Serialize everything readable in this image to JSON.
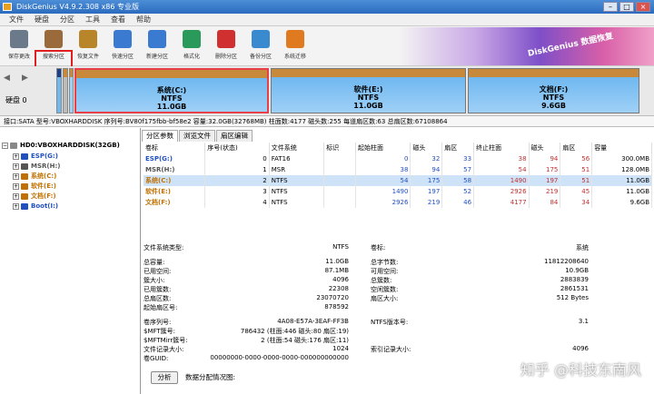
{
  "titlebar": {
    "title": "DiskGenius V4.9.2.308 x86 专业版"
  },
  "menu": [
    "文件",
    "硬盘",
    "分区",
    "工具",
    "查看",
    "帮助"
  ],
  "toolbar": [
    {
      "label": "保存更改",
      "color": "#6a7a8a"
    },
    {
      "label": "搜索分区",
      "color": "#9a6a3a"
    },
    {
      "label": "恢复文件",
      "color": "#b8852a"
    },
    {
      "label": "快速分区",
      "color": "#3a7ad0"
    },
    {
      "label": "新建分区",
      "color": "#3a7ad0"
    },
    {
      "label": "格式化",
      "color": "#2a9a5a"
    },
    {
      "label": "删除分区",
      "color": "#d03030"
    },
    {
      "label": "备份分区",
      "color": "#3a8ad0"
    },
    {
      "label": "系统迁移",
      "color": "#e07a20"
    }
  ],
  "banner_text": "DiskGenius 数据恢复",
  "disk_nav": {
    "label": "硬盘 0"
  },
  "partitions_bar": [
    {
      "name": "系统(C:)",
      "fs": "NTFS",
      "size": "11.0GB"
    },
    {
      "name": "软件(E:)",
      "fs": "NTFS",
      "size": "11.0GB"
    },
    {
      "name": "文档(F:)",
      "fs": "NTFS",
      "size": "9.6GB"
    }
  ],
  "infobar": "接口:SATA  型号:VBOXHARDDISK  序列号:BV80f175fbb-bf58e2  容量:32.0GB(32768MB)  柱面数:4177  磁头数:255  每道扇区数:63  总扇区数:67108864",
  "tree": {
    "disk": "HD0:VBOXHARDDISK(32GB)",
    "items": [
      {
        "label": "ESP(G:)",
        "color": "#2050c0"
      },
      {
        "label": "MSR(H:)",
        "color": "#555555"
      },
      {
        "label": "系统(C:)",
        "color": "#c07000"
      },
      {
        "label": "软件(E:)",
        "color": "#c07000"
      },
      {
        "label": "文档(F:)",
        "color": "#c07000"
      },
      {
        "label": "Boot(I:)",
        "color": "#2050c0"
      }
    ]
  },
  "tabs": [
    "分区参数",
    "浏览文件",
    "扇区编辑"
  ],
  "table": {
    "headers": [
      "卷标",
      "序号(状态)",
      "文件系统",
      "标识",
      "起始柱面",
      "磁头",
      "扇区",
      "终止柱面",
      "磁头",
      "扇区",
      "容量"
    ],
    "rows": [
      {
        "label": "ESP(G:)",
        "cells": [
          "0",
          "FAT16",
          "",
          "0",
          "32",
          "33",
          "38",
          "94",
          "56",
          "300.0MB"
        ]
      },
      {
        "label": "MSR(H:)",
        "cells": [
          "1",
          "MSR",
          "",
          "38",
          "94",
          "57",
          "54",
          "175",
          "51",
          "128.0MB"
        ]
      },
      {
        "label": "系统(C:)",
        "cells": [
          "2",
          "NTFS",
          "",
          "54",
          "175",
          "58",
          "1490",
          "197",
          "51",
          "11.0GB"
        ]
      },
      {
        "label": "软件(E:)",
        "cells": [
          "3",
          "NTFS",
          "",
          "1490",
          "197",
          "52",
          "2926",
          "219",
          "45",
          "11.0GB"
        ]
      },
      {
        "label": "文档(F:)",
        "cells": [
          "4",
          "NTFS",
          "",
          "2926",
          "219",
          "46",
          "4177",
          "84",
          "34",
          "9.6GB"
        ]
      }
    ]
  },
  "details": {
    "fs_type_label": "文件系统类型:",
    "fs_type": "NTFS",
    "vol_label": "卷标:",
    "vol": "系统",
    "rows1": [
      {
        "l": "总容量:",
        "v": "11.0GB",
        "l2": "总字节数:",
        "v2": "11812208640"
      },
      {
        "l": "已用空间:",
        "v": "87.1MB",
        "l2": "可用空间:",
        "v2": "10.9GB"
      },
      {
        "l": "簇大小:",
        "v": "4096",
        "l2": "总簇数:",
        "v2": "2883839"
      },
      {
        "l": "已用簇数:",
        "v": "22308",
        "l2": "空闲簇数:",
        "v2": "2861531"
      },
      {
        "l": "总扇区数:",
        "v": "23070720",
        "l2": "扇区大小:",
        "v2": "512 Bytes"
      },
      {
        "l": "起始扇区号:",
        "v": "878592",
        "l2": "",
        "v2": ""
      }
    ],
    "rows2": [
      {
        "l": "卷序列号:",
        "v": "4A08-E57A-3EAF-FF3B",
        "l2": "NTFS版本号:",
        "v2": "3.1"
      },
      {
        "l": "$MFT簇号:",
        "v": "786432 (柱面:446 磁头:80 扇区:19)",
        "l2": "",
        "v2": ""
      },
      {
        "l": "$MFTMirr簇号:",
        "v": "2 (柱面:54 磁头:176 扇区:11)",
        "l2": "",
        "v2": ""
      },
      {
        "l": "文件记录大小:",
        "v": "1024",
        "l2": "索引记录大小:",
        "v2": "4096"
      },
      {
        "l": "卷GUID:",
        "v": "00000000-0000-0000-0000-000000000000",
        "l2": "",
        "v2": ""
      }
    ]
  },
  "analyze_button": "分析",
  "alloc_label": "数据分配情况图:",
  "watermark": "知乎 @科技东南风"
}
